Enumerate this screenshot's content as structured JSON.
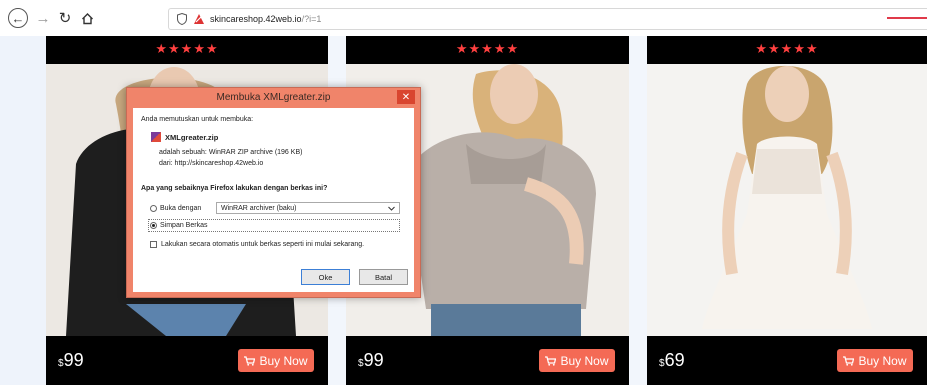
{
  "browser": {
    "url_host": "skincareshop.42web.io",
    "url_path": "/?i=1"
  },
  "products": [
    {
      "stars": "★★★★★",
      "price_currency": "$",
      "price_amount": "99",
      "buy_label": "Buy Now"
    },
    {
      "stars": "★★★★★",
      "price_currency": "$",
      "price_amount": "99",
      "buy_label": "Buy Now"
    },
    {
      "stars": "★★★★★",
      "price_currency": "$",
      "price_amount": "69",
      "buy_label": "Buy Now"
    }
  ],
  "dialog": {
    "title": "Membuka XMLgreater.zip",
    "close_label": "✕",
    "intro": "Anda memutuskan untuk membuka:",
    "file_name": "XMLgreater.zip",
    "type_line": "adalah sebuah:  WinRAR ZIP archive (196 KB)",
    "from_line": "dari:  http://skincareshop.42web.io",
    "question": "Apa yang sebaiknya Firefox lakukan dengan berkas ini?",
    "open_with_label": "Buka dengan",
    "open_with_app": "WinRAR archiver (baku)",
    "save_label": "Simpan Berkas",
    "auto_label": "Lakukan secara otomatis untuk berkas seperti ini mulai sekarang.",
    "ok_label": "Oke",
    "cancel_label": "Batal"
  },
  "colors": {
    "accent": "#f46a55",
    "star": "#ff4040",
    "dialog_frame": "#f0846a"
  },
  "icons": {
    "back": "back-arrow-icon",
    "forward": "forward-arrow-icon",
    "reload": "reload-icon",
    "home": "home-icon",
    "shield": "shield-icon",
    "cart": "cart-icon",
    "archive": "archive-icon",
    "close": "close-icon",
    "dropdown": "chevron-down-icon"
  }
}
